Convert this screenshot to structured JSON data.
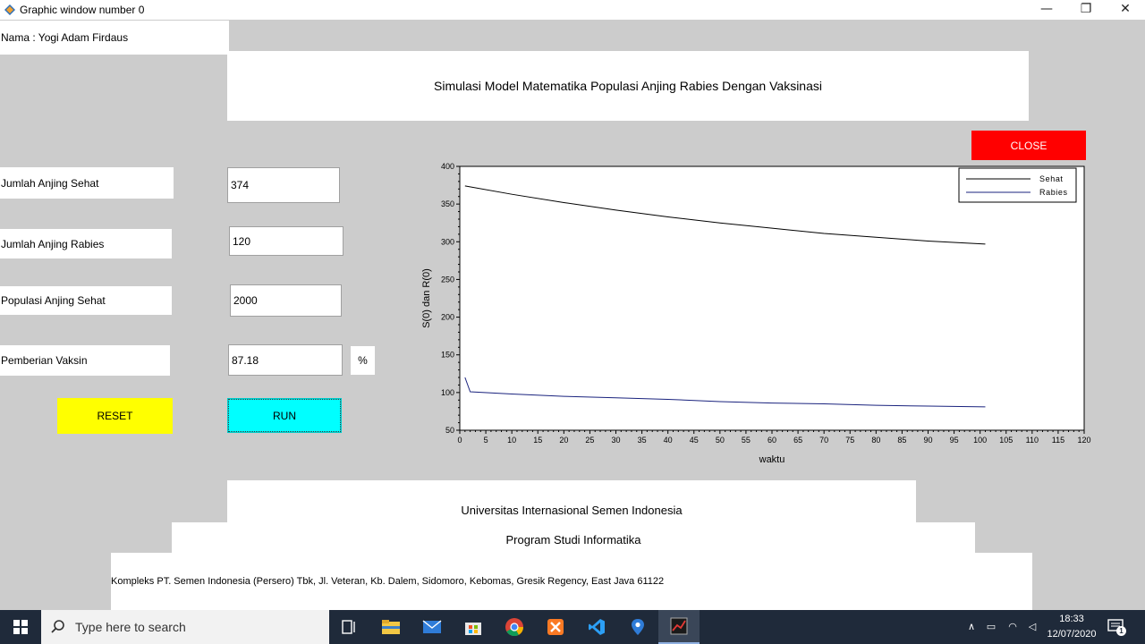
{
  "window": {
    "title": "Graphic window number 0",
    "minimize_glyph": "—",
    "restore_glyph": "❐",
    "close_glyph": "✕"
  },
  "header": {
    "author": "Nama : Yogi Adam Firdaus",
    "app_title": "Simulasi Model Matematika Populasi Anjing Rabies Dengan Vaksinasi"
  },
  "form": {
    "healthy_label": "Jumlah Anjing Sehat",
    "healthy_value": "374",
    "rabid_label": "Jumlah Anjing Rabies",
    "rabid_value": "120",
    "population_label": "Populasi Anjing Sehat",
    "population_value": "2000",
    "vaccine_label": "Pemberian Vaksin",
    "vaccine_value": "87.18",
    "vaccine_unit": "%"
  },
  "buttons": {
    "close": "CLOSE",
    "reset": "RESET",
    "run": "RUN"
  },
  "footer": {
    "university": "Universitas Internasional Semen Indonesia",
    "program": "Program Studi Informatika",
    "address": "Kompleks PT. Semen Indonesia (Persero) Tbk, Jl. Veteran, Kb. Dalem, Sidomoro, Kebomas, Gresik Regency, East Java 61122"
  },
  "chart_data": {
    "type": "line",
    "xlabel": "waktu",
    "ylabel": "S(0) dan R(0)",
    "xlim": [
      0,
      120
    ],
    "ylim": [
      50,
      400
    ],
    "xticks": [
      0,
      5,
      10,
      15,
      20,
      25,
      30,
      35,
      40,
      45,
      50,
      55,
      60,
      65,
      70,
      75,
      80,
      85,
      90,
      95,
      100,
      105,
      110,
      115,
      120
    ],
    "yticks": [
      50,
      100,
      150,
      200,
      250,
      300,
      350,
      400
    ],
    "legend_position": "top-right",
    "grid": false,
    "series": [
      {
        "name": "Sehat",
        "color": "#000000",
        "x": [
          1,
          10,
          20,
          30,
          40,
          50,
          60,
          70,
          80,
          90,
          101
        ],
        "y": [
          374,
          363,
          352,
          342,
          333,
          325,
          318,
          311,
          306,
          301,
          297
        ]
      },
      {
        "name": "Rabies",
        "color": "#1a237e",
        "x": [
          1,
          2,
          10,
          20,
          30,
          40,
          50,
          60,
          70,
          80,
          90,
          101
        ],
        "y": [
          120,
          101,
          98,
          95,
          93,
          91,
          88,
          86,
          85,
          83,
          82,
          81
        ]
      }
    ]
  },
  "taskbar": {
    "search_placeholder": "Type here to search",
    "time": "18:33",
    "date": "12/07/2020",
    "notification_count": "1"
  }
}
